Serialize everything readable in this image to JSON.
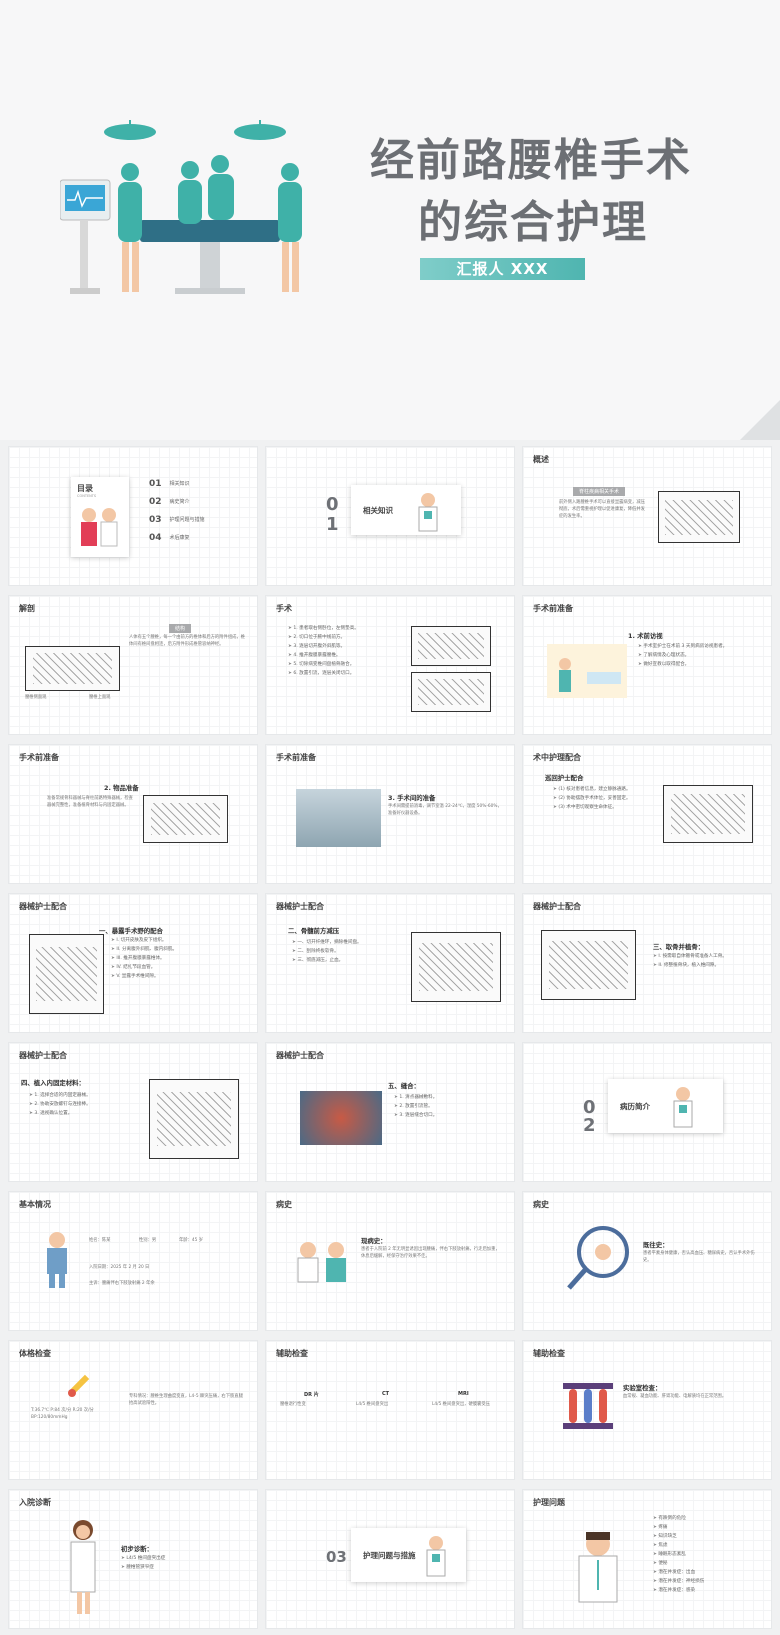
{
  "cover": {
    "title_line1": "经前路腰椎手术",
    "title_line2": "的综合护理",
    "reporter": "汇报人 XXX"
  },
  "slides": {
    "toc": {
      "title": "目录",
      "title_en": "CONTENTS",
      "items": [
        {
          "num": "01",
          "label": "相关知识"
        },
        {
          "num": "02",
          "label": "病史简介"
        },
        {
          "num": "03",
          "label": "护理问题与措施"
        },
        {
          "num": "04",
          "label": "术后康复"
        }
      ]
    },
    "sec01": {
      "num": "0\n1",
      "num_a": "0",
      "num_b": "1",
      "label": "相关知识"
    },
    "overview": {
      "title": "概述",
      "tag": "脊柱疾病相关手术",
      "body": "前外侧入路腰椎手术可以直接显露病变，减压彻底，术后需重视护理以促进康复，降低并发症的发生率。"
    },
    "anatomy": {
      "title": "解剖",
      "tag": "结构",
      "caption_left": "腰椎侧面观",
      "caption_right": "腰椎上面观",
      "body": "人体有五个腰椎，每一个由前方的椎体和后方的附件组成，椎体间有椎间盘相连，后方附件形成椎管容纳神经。"
    },
    "surgery": {
      "title": "手术",
      "items": [
        "1. 患者取右侧卧位，左侧垫高。",
        "2. 切口位于腋中线前方。",
        "3. 逐层切开腹外斜肌等。",
        "4. 推开腹膜暴露腰椎。",
        "5. 切除病变椎间盘植骨融合。",
        "6. 放置引流，逐层关闭切口。"
      ]
    },
    "prep1": {
      "title": "手术前准备",
      "sub": "1. 术前访视",
      "items": [
        "手术室护士在术前 3 天到病房访视患者。",
        "了解病情及心理状态。",
        "做好宣教以取得配合。"
      ]
    },
    "prep2": {
      "title": "手术前准备",
      "sub": "2. 物品准备",
      "body": "准备常规骨科器械与脊柱前路特殊器械，检查器械完整性，准备植骨材料与内固定器械。"
    },
    "prep3": {
      "title": "手术前准备",
      "sub": "3. 手术间的准备",
      "body": "手术间需提前消毒，调节室温 22-24℃，湿度 50%-60%，准备好仪器设备。"
    },
    "intraop": {
      "title": "术中护理配合",
      "sub": "巡回护士配合",
      "items": [
        "(1) 核对患者信息，建立静脉通路。",
        "(2) 协助摆放手术体位，妥善固定。",
        "(3) 术中密切观察生命体征。"
      ]
    },
    "scrub1": {
      "title": "器械护士配合",
      "sub": "一、暴露手术野的配合",
      "items": [
        "I. 切开皮肤及皮下组织。",
        "II. 分离腹外斜肌、腹内斜肌。",
        "III. 推开腹膜暴露椎体。",
        "IV. 结扎节段血管。",
        "V. 显露手术椎间隙。"
      ]
    },
    "scrub2": {
      "title": "器械护士配合",
      "sub": "二、骨髓前方减压",
      "items": [
        "一、切开纤维环，摘除椎间盘。",
        "二、刮除终板软骨。",
        "三、彻底减压，止血。"
      ]
    },
    "scrub3": {
      "title": "器械护士配合",
      "sub": "三、取骨并植骨：",
      "items": [
        "I. 按需取自体髂骨或准备人工骨。",
        "II. 修整植骨块，植入椎间隙。"
      ]
    },
    "scrub4": {
      "title": "器械护士配合",
      "sub": "四、植入内固定材料：",
      "items": [
        "1. 选择合适的内固定器械。",
        "2. 协助安放螺钉与连接棒。",
        "3. 透视确认位置。"
      ]
    },
    "scrub5": {
      "title": "器械护士配合",
      "sub": "五、缝合：",
      "items": [
        "1. 清点器械敷料。",
        "2. 放置引流管。",
        "3. 逐层缝合切口。"
      ]
    },
    "sec02": {
      "num_a": "0",
      "num_b": "2",
      "label": "病历简介"
    },
    "basic": {
      "title": "基本情况",
      "fields": [
        "姓名：陈某",
        "性别：男",
        "年龄：45 岁",
        "入院日期：2025 年 2 月 20 日",
        "主诉：腰痛伴右下肢放射痛 2 年余"
      ]
    },
    "history1": {
      "title": "病史",
      "sub": "现病史：",
      "body": "患者于入院前 2 年无明显诱因出现腰痛，伴右下肢放射痛，行走后加重，休息后缓解，经保守治疗效果不佳。"
    },
    "history2": {
      "title": "病史",
      "sub": "既往史：",
      "body": "患者平素身体健康，否认高血压、糖尿病史，否认手术外伤史。"
    },
    "exam": {
      "title": "体格检查",
      "vitals": "T:36.7℃  P:84 次/分  R:20 次/分  BP:120/80mmHg",
      "body": "专科情况：腰椎生理曲度变直，L4-5 棘突压痛，右下肢直腿抬高试验阳性。"
    },
    "aux1": {
      "title": "辅助检查",
      "cols": [
        {
          "head": "DR 片",
          "body": "腰椎退行性变"
        },
        {
          "head": "CT",
          "body": "L4/5 椎间盘突出"
        },
        {
          "head": "MRI",
          "body": "L4/5 椎间盘突出，硬膜囊受压"
        }
      ]
    },
    "aux2": {
      "title": "辅助检查",
      "sub": "实验室检查：",
      "body": "血常规、凝血功能、肝肾功能、电解质均在正常范围。"
    },
    "diag": {
      "title": "入院诊断",
      "sub": "初步诊断：",
      "items": [
        "L4/5 椎间盘突出症",
        "腰椎管狭窄症"
      ]
    },
    "sec03": {
      "num": "03",
      "label": "护理问题与措施"
    },
    "nursing": {
      "title": "护理问题",
      "items": [
        "有跌倒的危险",
        "疼痛",
        "知识缺乏",
        "焦虑",
        "睡眠形态紊乱",
        "便秘",
        "潜在并发症：出血",
        "潜在并发症：神经损伤",
        "潜在并发症：感染"
      ]
    }
  }
}
